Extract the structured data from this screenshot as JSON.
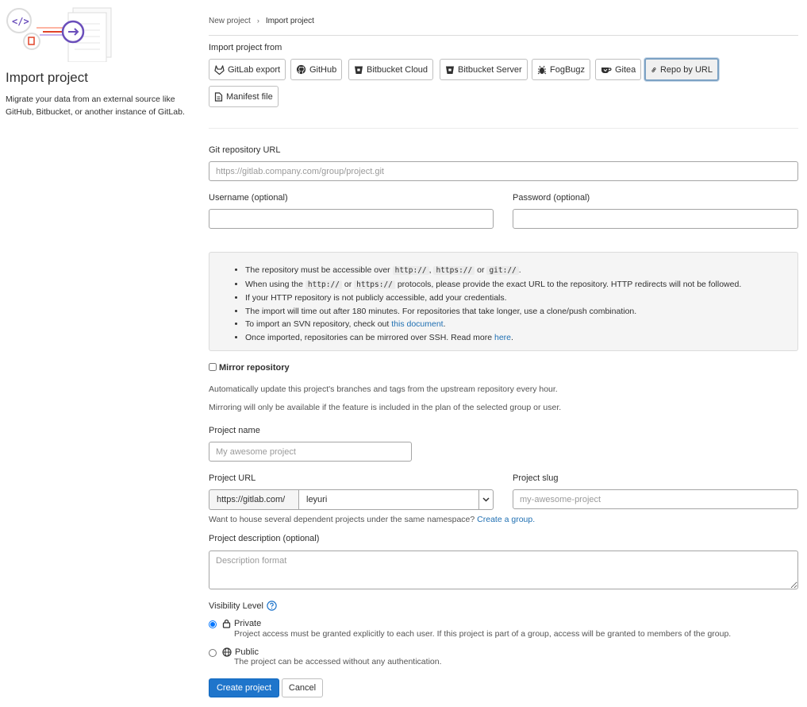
{
  "breadcrumb": {
    "parent": "New project",
    "current": "Import project"
  },
  "left": {
    "title": "Import project",
    "description": "Migrate your data from an external source like GitHub, Bitbucket, or another instance of GitLab."
  },
  "import_from": {
    "label": "Import project from",
    "sources": [
      {
        "label": "GitLab export",
        "icon": "gitlab-icon"
      },
      {
        "label": "GitHub",
        "icon": "github-icon"
      },
      {
        "label": "Bitbucket Cloud",
        "icon": "bitbucket-icon"
      },
      {
        "label": "Bitbucket Server",
        "icon": "bitbucket-icon"
      },
      {
        "label": "FogBugz",
        "icon": "bug-icon"
      },
      {
        "label": "Gitea",
        "icon": "gitea-icon"
      },
      {
        "label": "Repo by URL",
        "icon": "link-icon",
        "selected": true
      },
      {
        "label": "Manifest file",
        "icon": "document-icon"
      }
    ]
  },
  "repo_form": {
    "git_url_label": "Git repository URL",
    "git_url_placeholder": "https://gitlab.company.com/group/project.git",
    "username_label": "Username (optional)",
    "password_label": "Password (optional)"
  },
  "info": {
    "item1_pre": "The repository must be accessible over",
    "code_http": "http://",
    "code_https": "https://",
    "code_git": "git://",
    "sep_comma": ",",
    "sep_or": "or",
    "period": ".",
    "item2_pre": "When using the",
    "item2_post": "protocols, please provide the exact URL to the repository. HTTP redirects will not be followed.",
    "item3": "If your HTTP repository is not publicly accessible, add your credentials.",
    "item4": "The import will time out after 180 minutes. For repositories that take longer, use a clone/push combination.",
    "item5_pre": "To import an SVN repository, check out",
    "item5_link": "this document",
    "item6_pre": "Once imported, repositories can be mirrored over SSH. Read more",
    "item6_link": "here"
  },
  "mirror": {
    "label": "Mirror repository",
    "help1": "Automatically update this project's branches and tags from the upstream repository every hour.",
    "help2": "Mirroring will only be available if the feature is included in the plan of the selected group or user."
  },
  "project": {
    "name_label": "Project name",
    "name_placeholder": "My awesome project",
    "url_label": "Project URL",
    "url_prefix": "https://gitlab.com/",
    "namespace": "leyuri",
    "slug_label": "Project slug",
    "slug_placeholder": "my-awesome-project",
    "group_help": "Want to house several dependent projects under the same namespace?",
    "group_link": "Create a group.",
    "desc_label": "Project description (optional)",
    "desc_placeholder": "Description format"
  },
  "visibility": {
    "label": "Visibility Level",
    "private_label": "Private",
    "private_help": "Project access must be granted explicitly to each user. If this project is part of a group, access will be granted to members of the group.",
    "public_label": "Public",
    "public_help": "The project can be accessed without any authentication."
  },
  "actions": {
    "create": "Create project",
    "cancel": "Cancel"
  },
  "colors": {
    "primary": "#1f75cb",
    "link": "#1f6fb2",
    "accent_purple": "#6b4fbb",
    "accent_orange": "#e24329"
  }
}
